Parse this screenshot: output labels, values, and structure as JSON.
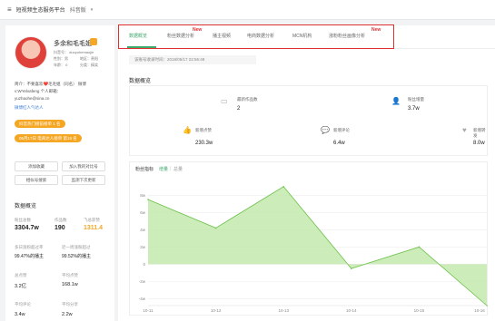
{
  "topbar": {
    "menu_icon": "≡",
    "title": "短视频生态服务平台",
    "platform": "抖音版"
  },
  "profile": {
    "name": "多余和毛毛姐",
    "douyin_id": "抖音号： duoyuhemaojie",
    "gender": "性别：男",
    "region": "地区：贵阳",
    "age": "年龄： 0",
    "industry": "分类：搞笑",
    "bio_line1": "简介：不要喜欢❤️毛毛姐（同名）  微博",
    "bio_line2": "v:WYelvafeng 个人邮箱：",
    "bio_line3": "yuzhaohe@sina.cn",
    "verified": "微博红人气达人",
    "tag1": "抖音热门榜前榜单 1 名",
    "tag2": "06月17日 电商达人榜单 第19 名",
    "btn_follow": "添加收藏",
    "btn_compare": "加入我的对比号",
    "btn_search": "相似号搜索",
    "btn_monitor": "监测下次更新"
  },
  "overview": {
    "title": "数据概览",
    "fans_label": "粉丝总数",
    "fans_value": "3304.7w",
    "works_label": "作品数",
    "works_value": "190",
    "likes_label": "飞总获赞",
    "likes_value": "1311.4",
    "beat1_label": "多日涨粉超过率",
    "beat1_value": "99.47%的播主",
    "beat2_label": "近一周涨粉超过",
    "beat2_value": "99.52%的播主",
    "total_likes_label": "总点赞",
    "total_likes_value": "3.2亿",
    "avg_likes_label": "平均点赞",
    "avg_likes_value": "168.1w",
    "avg_comment_label": "平均评论",
    "avg_comment_value": "3.4w",
    "avg_share_label": "平均分享",
    "avg_share_value": "2.2w"
  },
  "tabs": [
    {
      "label": "数据概览",
      "new": ""
    },
    {
      "label": "粉丝数据分析",
      "new": "New"
    },
    {
      "label": "播主视频",
      "new": ""
    },
    {
      "label": "电商数据分析",
      "new": ""
    },
    {
      "label": "MCN机构",
      "new": ""
    },
    {
      "label": "涨粉粉丝画像分析",
      "new": "New"
    }
  ],
  "main": {
    "updated": "该账号收录时间：2018/05/17 22:56:48",
    "section_title": "数据概览",
    "recent_works_label": "最新作品数",
    "recent_works_value": "2",
    "fans_incr_label": "粉丝增量",
    "fans_incr_value": "3.7w",
    "new_likes_label": "新增点赞",
    "new_likes_value": "230.3w",
    "new_comments_label": "新增评论",
    "new_comments_value": "6.4w",
    "new_shares_label": "新增转发",
    "new_shares_value": "8.0w",
    "chart_title": "粉丝指标",
    "chart_tab_active": "增量",
    "chart_tab_sep": "|",
    "chart_tab_other": "总量"
  },
  "colors": {
    "accent": "#3fa66c",
    "fill": "#bfe7a8",
    "line": "#6cc04a",
    "highlight": "#e03030",
    "orange": "#f5a623"
  },
  "chart_data": {
    "type": "area",
    "x": [
      "10-11",
      "10-12",
      "10-13",
      "10-14",
      "10-15",
      "10-16"
    ],
    "values": [
      7.5,
      4.2,
      9.0,
      -0.5,
      2.0,
      -4.8
    ],
    "yticks": [
      "8w",
      "6w",
      "4w",
      "2w",
      "0",
      "-2w",
      "-4w"
    ],
    "ylim": [
      -4.8,
      9.5
    ],
    "grid": true
  }
}
